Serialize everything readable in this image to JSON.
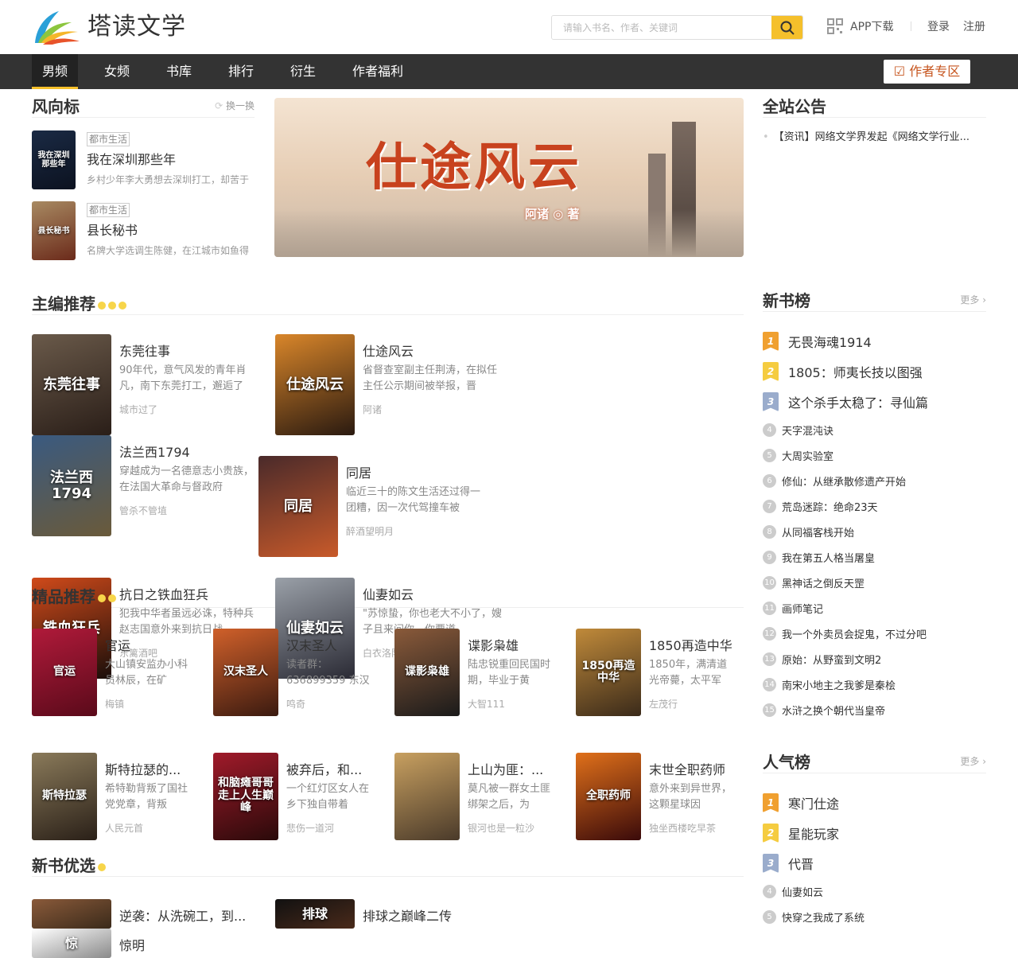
{
  "header": {
    "logo_text": "塔读文学",
    "search_placeholder": "请输入书名、作者、关键词",
    "app_download": "APP下载",
    "login": "登录",
    "register": "注册"
  },
  "nav": {
    "items": [
      "男频",
      "女频",
      "书库",
      "排行",
      "衍生",
      "作者福利"
    ],
    "active": 0,
    "author_zone": "作者专区"
  },
  "vane": {
    "title": "风向标",
    "refresh": "换一换",
    "books": [
      {
        "tag": "都市生活",
        "title": "我在深圳那些年",
        "desc": "乡村少年李大勇想去深圳打工，却苦于",
        "cover_text": "我在深圳那些年",
        "colors": [
          "#1a2a44",
          "#0c1220"
        ]
      },
      {
        "tag": "都市生活",
        "title": "县长秘书",
        "desc": "名牌大学选调生陈健，在江城市如鱼得",
        "cover_text": "县长秘书",
        "colors": [
          "#a88a62",
          "#6b2a1a"
        ]
      }
    ]
  },
  "banner": {
    "title": "仕途风云",
    "author": "阿诸 ◎ 著"
  },
  "notice": {
    "title": "全站公告",
    "items": [
      "【资讯】网络文学界发起《网络文学行业..."
    ]
  },
  "editor": {
    "title": "主编推荐",
    "books": [
      {
        "title": "东莞往事",
        "desc": "90年代，意气风发的青年肖凡，南下东莞打工，邂逅了",
        "author": "城市过了",
        "cover_text": "东莞往事",
        "colors": [
          "#6a5a4a",
          "#2a1e18"
        ]
      },
      {
        "title": "仕途风云",
        "desc": "省督查室副主任荆涛，在拟任主任公示期间被举报，晋",
        "author": "阿诸",
        "cover_text": "仕途风云",
        "colors": [
          "#d9862a",
          "#2a1a10"
        ]
      },
      {
        "title": "法兰西1794",
        "desc": "穿越成为一名德意志小贵族，在法国大革命与督政府",
        "author": "管杀不管埴",
        "cover_text": "法兰西1794",
        "colors": [
          "#3a5a80",
          "#6a5a3a"
        ]
      },
      {
        "title": "同居",
        "desc": "临近三十的陈文生活还过得一团糟，因一次代驾撞车被",
        "author": "醉酒望明月",
        "cover_text": "同居",
        "colors": [
          "#4a2a2a",
          "#c85a2a"
        ]
      },
      {
        "title": "抗日之铁血狂兵",
        "desc": "犯我中华者虽远必诛，特种兵赵志国意外来到抗日战",
        "author": "东篱酒吧",
        "cover_text": "铁血狂兵",
        "colors": [
          "#d04a1a",
          "#1a0e0a"
        ]
      },
      {
        "title": "仙妻如云",
        "desc": "\"苏惊蛰，你也老大不小了，嫂子且来问你，你要道",
        "author": "白衣洛阳",
        "cover_text": "仙妻如云",
        "colors": [
          "#9aa0a8",
          "#2a2a34"
        ]
      }
    ]
  },
  "quality": {
    "title": "精品推荐",
    "books": [
      {
        "title": "官运",
        "desc": "大山镇安监办小科员林辰，在矿",
        "author": "梅镇",
        "cover_text": "官运",
        "colors": [
          "#b01a3a",
          "#5a0a1a"
        ]
      },
      {
        "title": "汉末圣人",
        "desc": "读者群：636899359 东汉",
        "author": "鸣奇",
        "cover_text": "汉末圣人",
        "colors": [
          "#d0602a",
          "#3a1a10"
        ]
      },
      {
        "title": "谍影枭雄",
        "desc": "陆忠锐重回民国时期，毕业于黄",
        "author": "大智111",
        "cover_text": "谍影枭雄",
        "colors": [
          "#8a5a3a",
          "#1a1a1a"
        ]
      },
      {
        "title": "1850再造中华",
        "desc": "1850年，满清道光帝薨，太平军",
        "author": "左茂行",
        "cover_text": "1850再造中华",
        "colors": [
          "#c08a3a",
          "#3a2a1a"
        ]
      },
      {
        "title": "斯特拉瑟的...",
        "desc": "希特勒背叛了国社党党章，背叛",
        "author": "人民元首",
        "cover_text": "斯特拉瑟",
        "colors": [
          "#8a7a5a",
          "#2a2018"
        ]
      },
      {
        "title": "被弃后，和...",
        "desc": "一个红灯区女人在乡下独自带着",
        "author": "悲伤一道河",
        "cover_text": "和脑瘫哥哥走上人生巅峰",
        "colors": [
          "#a01a2a",
          "#2a0a0a"
        ]
      },
      {
        "title": "上山为匪：...",
        "desc": "莫凡被一群女土匪绑架之后，为",
        "author": "银河也是一粒沙",
        "cover_text": "",
        "colors": [
          "#c8a060",
          "#4a3a2a"
        ]
      },
      {
        "title": "末世全职药师",
        "desc": "意外来到异世界，这颗星球因",
        "author": "独坐西楼吃早茶",
        "cover_text": "全职药师",
        "colors": [
          "#e0701a",
          "#3a0a0a"
        ]
      }
    ]
  },
  "newpick": {
    "title": "新书优选",
    "books": [
      {
        "title": "逆袭：从洗碗工，到...",
        "cover_text": "",
        "colors": [
          "#8a5a3a",
          "#3a2a1a"
        ]
      },
      {
        "title": "排球之巅峰二传",
        "cover_text": "排球",
        "colors": [
          "#111111",
          "#4a2a1a"
        ]
      },
      {
        "title": "惊明",
        "cover_text": "惊",
        "colors": [
          "#ffffff",
          "#8a8a8a"
        ]
      }
    ]
  },
  "newrank": {
    "title": "新书榜",
    "more": "更多",
    "items": [
      "无畏海魂1914",
      "1805：师夷长技以图强",
      "这个杀手太稳了：寻仙篇",
      "天字混沌诀",
      "大周实验室",
      "修仙：从继承散修遗产开始",
      "荒岛迷踪：绝命23天",
      "从同福客栈开始",
      "我在第五人格当屠皇",
      "黑神话之倒反天罡",
      "画师笔记",
      "我一个外卖员会捉鬼，不过分吧",
      "原始：从野蛮到文明2",
      "南宋小地主之我爹是秦桧",
      "水浒之换个朝代当皇帝"
    ]
  },
  "poprank": {
    "title": "人气榜",
    "more": "更多",
    "items": [
      "寒门仕途",
      "星能玩家",
      "代晋",
      "仙妻如云",
      "快穿之我成了系统"
    ]
  },
  "colors": {
    "accent": "#f5c02b",
    "nav_bg": "#333333",
    "author_zone": "#c6541d",
    "medal": [
      "#f0a030",
      "#f5cc40",
      "#9aaccc"
    ]
  }
}
